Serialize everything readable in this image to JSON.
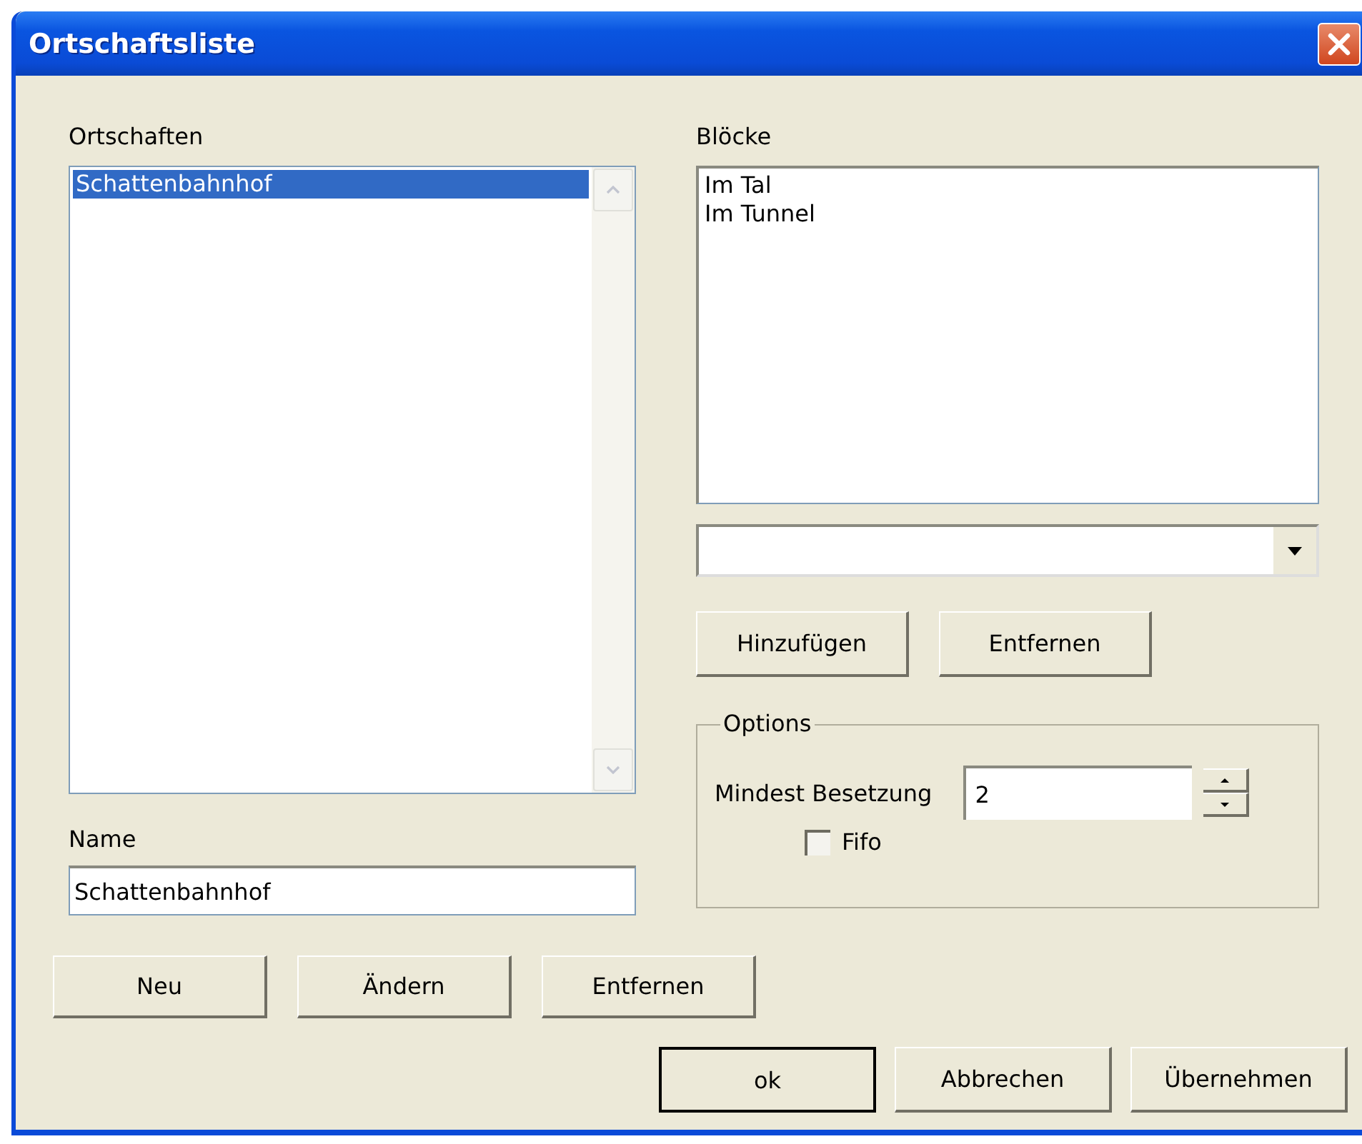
{
  "window": {
    "title": "Ortschaftsliste"
  },
  "ortschaften": {
    "label": "Ortschaften",
    "items": [
      {
        "text": "Schattenbahnhof",
        "selected": true
      }
    ]
  },
  "name": {
    "label": "Name",
    "value": "Schattenbahnhof"
  },
  "bloecke": {
    "label": "Blöcke",
    "items": [
      {
        "text": "Im Tal",
        "selected": false
      },
      {
        "text": "Im Tunnel",
        "selected": false
      }
    ]
  },
  "block_buttons": [
    "Hinzufügen",
    "Entfernen"
  ],
  "options": {
    "title": "Options",
    "min_label": "Mindest Besetzung",
    "min_value": "2",
    "fifo": {
      "label": "Fifo",
      "checked": false
    }
  },
  "list_buttons": [
    "Neu",
    "Ändern",
    "Entfernen"
  ],
  "dialog_buttons": [
    {
      "label": "ok",
      "default": true
    },
    {
      "label": "Abbrechen",
      "default": false
    },
    {
      "label": "Übernehmen",
      "default": false
    }
  ]
}
